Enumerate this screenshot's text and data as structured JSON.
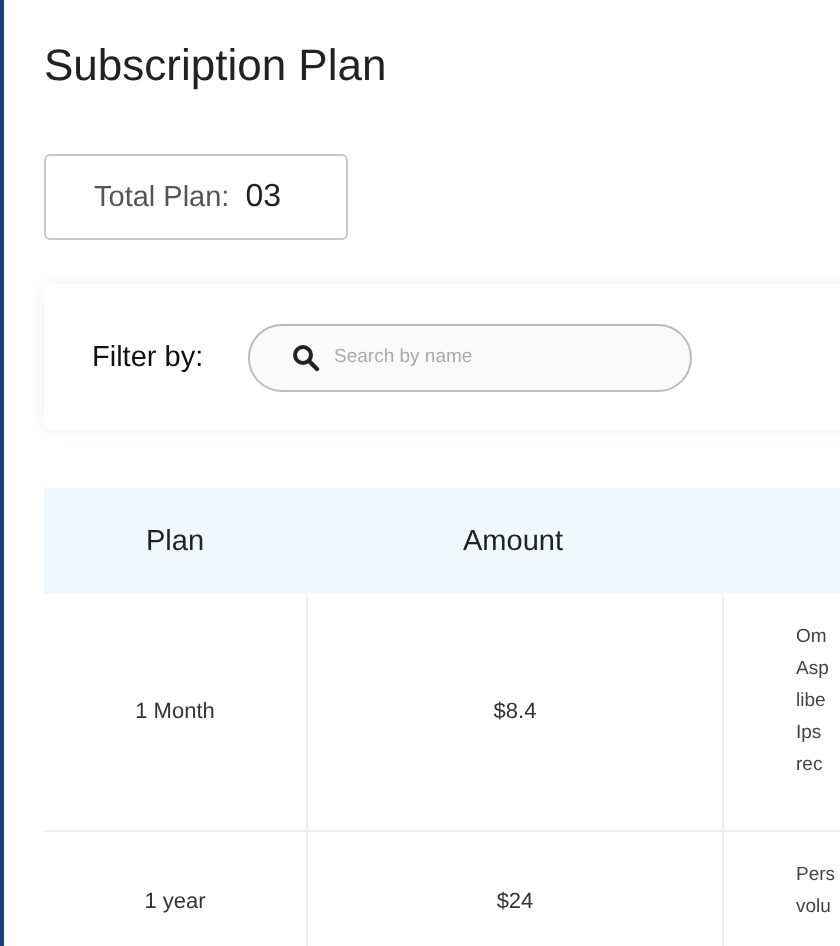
{
  "title": "Subscription Plan",
  "total": {
    "label": "Total Plan:",
    "value": "03"
  },
  "filter": {
    "label": "Filter by:",
    "placeholder": "Search by name"
  },
  "table": {
    "columns": [
      "Plan",
      "Amount"
    ],
    "rows": [
      {
        "plan": "1 Month",
        "amount": "$8.4",
        "column_3": [
          "Om",
          "Asp",
          "libe",
          "Ips",
          "rec"
        ]
      },
      {
        "plan": "1 year",
        "amount": "$24",
        "column_3": [
          "Pers",
          "volu"
        ]
      }
    ]
  }
}
